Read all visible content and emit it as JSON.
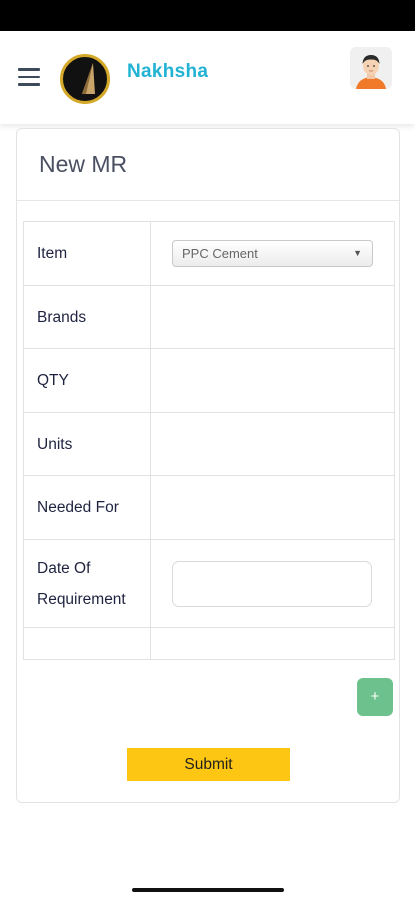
{
  "app": {
    "brand_name": "Nakhsha",
    "brand_color": "#21b2d4"
  },
  "header": {
    "menu_icon": "hamburger-menu-icon",
    "logo_icon": "nakhsha-logo",
    "avatar_icon": "user-avatar"
  },
  "page": {
    "title": "New MR"
  },
  "form": {
    "rows": [
      {
        "label": "Item",
        "control": "select",
        "value": "PPC Cement"
      },
      {
        "label": "Brands"
      },
      {
        "label": "QTY"
      },
      {
        "label": "Units"
      },
      {
        "label": "Needed For"
      },
      {
        "label_line1": "Date Of",
        "label_line2": "Requirement",
        "control": "date",
        "value": ""
      }
    ]
  },
  "actions": {
    "add_label": "+",
    "add_color": "#6cc18c",
    "submit_label": "Submit",
    "submit_color": "#fcc613"
  }
}
